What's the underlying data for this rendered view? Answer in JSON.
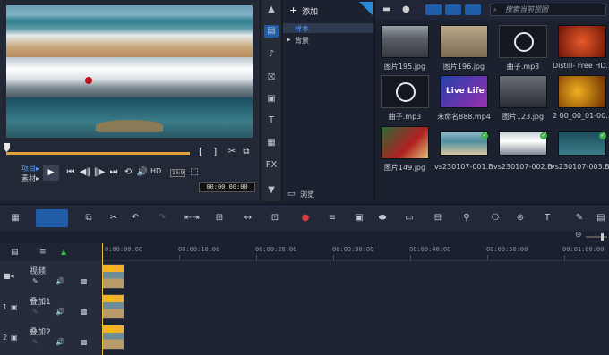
{
  "preview": {
    "marker_in": "[",
    "marker_out": "]",
    "mode_project": "项目▸",
    "mode_clip": "素材▸",
    "hd_label": "HD",
    "aspect": "16:9",
    "timecode": "00:00:00:00"
  },
  "side_icons": [
    "media-icon",
    "instant-project-icon",
    "transition-icon",
    "title-icon",
    "text-icon",
    "graphics-icon",
    "fx-label",
    "down-arrow-icon"
  ],
  "side_fx_label": "FX",
  "library": {
    "add_label": "添加",
    "tree": [
      {
        "label": "样本",
        "selected": true
      },
      {
        "label": "背景",
        "selected": false
      }
    ],
    "browse_label": "浏览"
  },
  "gallery": {
    "search_placeholder": "搜索当前视图",
    "items": [
      {
        "label": "图片195.jpg",
        "kind": "city"
      },
      {
        "label": "图片196.jpg",
        "kind": "cars"
      },
      {
        "label": "曲子.mp3",
        "kind": "audio"
      },
      {
        "label": "Distill- Free HD...",
        "kind": "bokeh"
      },
      {
        "label": "曲子.mp3",
        "kind": "audio"
      },
      {
        "label": "未命名888.mp4",
        "kind": "live"
      },
      {
        "label": "图片123.jpg",
        "kind": "wave"
      },
      {
        "label": "2 00_00_01-00...",
        "kind": "lights"
      },
      {
        "label": "图片149.jpg",
        "kind": "xmas"
      },
      {
        "label": "vs230107-001.B...",
        "kind": "beach"
      },
      {
        "label": "vs230107-002.B...",
        "kind": "beach2"
      },
      {
        "label": "vs230107-003.B...",
        "kind": "sea"
      }
    ],
    "live_text": "Live Life"
  },
  "ruler": [
    "0:00:00:00",
    "00:00:10:00",
    "00:00:20:00",
    "00:00:30:00",
    "00:00:40:00",
    "00:00:50:00",
    "00:01:00:00"
  ],
  "tracks": [
    {
      "index": "",
      "name": "视频"
    },
    {
      "index": "1",
      "name": "叠加1"
    },
    {
      "index": "2",
      "name": "叠加2"
    }
  ],
  "colors": {
    "accent": "#1f5da8",
    "scrub": "#e2a23a",
    "check": "#3db24a"
  }
}
